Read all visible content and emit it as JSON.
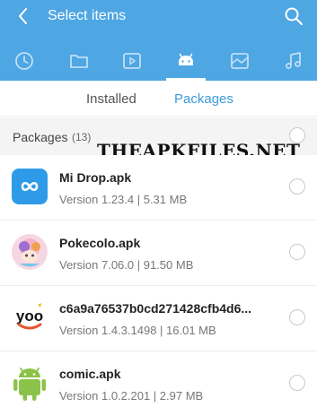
{
  "header": {
    "title": "Select items",
    "back_icon": "back-arrow-icon",
    "search_icon": "search-icon",
    "background": "#4ea6e3"
  },
  "category_tabs": [
    {
      "name": "recent",
      "icon": "clock-icon",
      "selected": false
    },
    {
      "name": "folders",
      "icon": "folder-icon",
      "selected": false
    },
    {
      "name": "videos",
      "icon": "video-icon",
      "selected": false
    },
    {
      "name": "apps",
      "icon": "android-icon",
      "selected": true
    },
    {
      "name": "images",
      "icon": "image-icon",
      "selected": false
    },
    {
      "name": "music",
      "icon": "music-icon",
      "selected": false
    }
  ],
  "subtabs": {
    "installed": "Installed",
    "packages": "Packages",
    "active": "Packages",
    "active_color": "#3a9bdc"
  },
  "group": {
    "title": "Packages",
    "count": "(13)"
  },
  "watermark": "THEAPKFILES.NET",
  "packages": [
    {
      "name": "Mi Drop.apk",
      "meta": "Version 1.23.4 | 5.31 MB",
      "icon": "mi-drop-app-icon"
    },
    {
      "name": "Pokecolo.apk",
      "meta": "Version 7.06.0 | 91.50 MB",
      "icon": "pokecolo-app-icon"
    },
    {
      "name": "c6a9a76537b0cd271428cfb4d6...",
      "meta": "Version 1.4.3.1498 | 16.01 MB",
      "icon": "yoo-app-icon"
    },
    {
      "name": "comic.apk",
      "meta": "Version 1.0.2.201 | 2.97 MB",
      "icon": "android-app-icon"
    }
  ]
}
